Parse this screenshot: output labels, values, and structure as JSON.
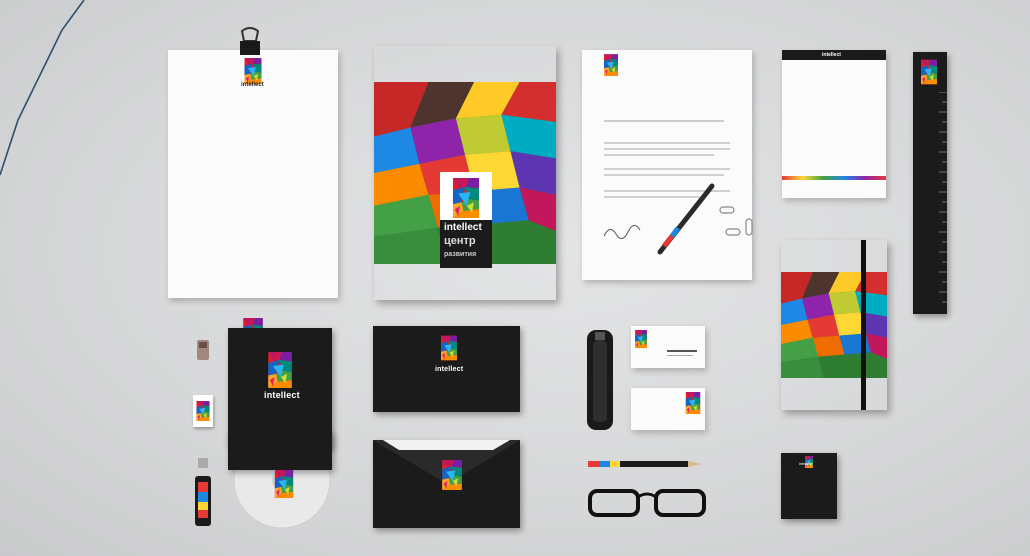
{
  "brand": {
    "name": "intellect",
    "cyrillic_line1": "центр",
    "cyrillic_line2": "развития"
  },
  "colors": {
    "background": "#d9dadb",
    "accent_frame": "#2d4f6c",
    "paper": "#fbfbfb",
    "black_item": "#1b1b1c"
  },
  "icons": [
    "binder-clip-icon",
    "pen-icon",
    "paperclip-icon",
    "stapler-icon",
    "glasses-icon",
    "usb-drive-icon",
    "sharpener-icon",
    "pencil-icon",
    "cd-icon"
  ]
}
